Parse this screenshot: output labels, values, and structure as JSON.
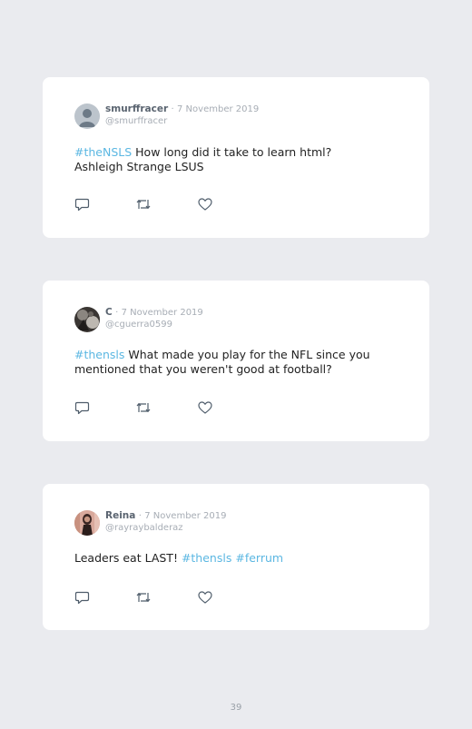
{
  "tweets": [
    {
      "name": "smurffracer",
      "separator": "·",
      "date": "7 November 2019",
      "handle": "@smurffracer",
      "avatar": "default-profile-avatar",
      "text_parts": [
        {
          "text": "#theNSLS",
          "hashtag": true
        },
        {
          "text": " How long did it take to learn html? Ashleigh Strange LSUS",
          "hashtag": false
        }
      ]
    },
    {
      "name": "C",
      "separator": "·",
      "date": "7 November 2019",
      "handle": "@cguerra0599",
      "avatar": "photo-avatar-dark",
      "text_parts": [
        {
          "text": "#thensls",
          "hashtag": true
        },
        {
          "text": " What made you play for the NFL since you mentioned that you weren't good at football?",
          "hashtag": false
        }
      ]
    },
    {
      "name": "Reina",
      "separator": "·",
      "date": "7 November 2019",
      "handle": "@rayraybalderaz",
      "avatar": "photo-avatar-person",
      "text_parts": [
        {
          "text": "Leaders eat LAST! ",
          "hashtag": false
        },
        {
          "text": "#thensls",
          "hashtag": true
        },
        {
          "text": " ",
          "hashtag": false
        },
        {
          "text": "#ferrum",
          "hashtag": true
        }
      ]
    }
  ],
  "actions": {
    "reply_icon": "reply-icon",
    "retweet_icon": "retweet-icon",
    "like_icon": "heart-icon"
  },
  "colors": {
    "background": "#eaebef",
    "card": "#ffffff",
    "hashtag": "#5bb7e2",
    "name": "#5a6470",
    "muted": "#a7adb5",
    "icon": "#4f5d6b"
  },
  "page_number": "39"
}
